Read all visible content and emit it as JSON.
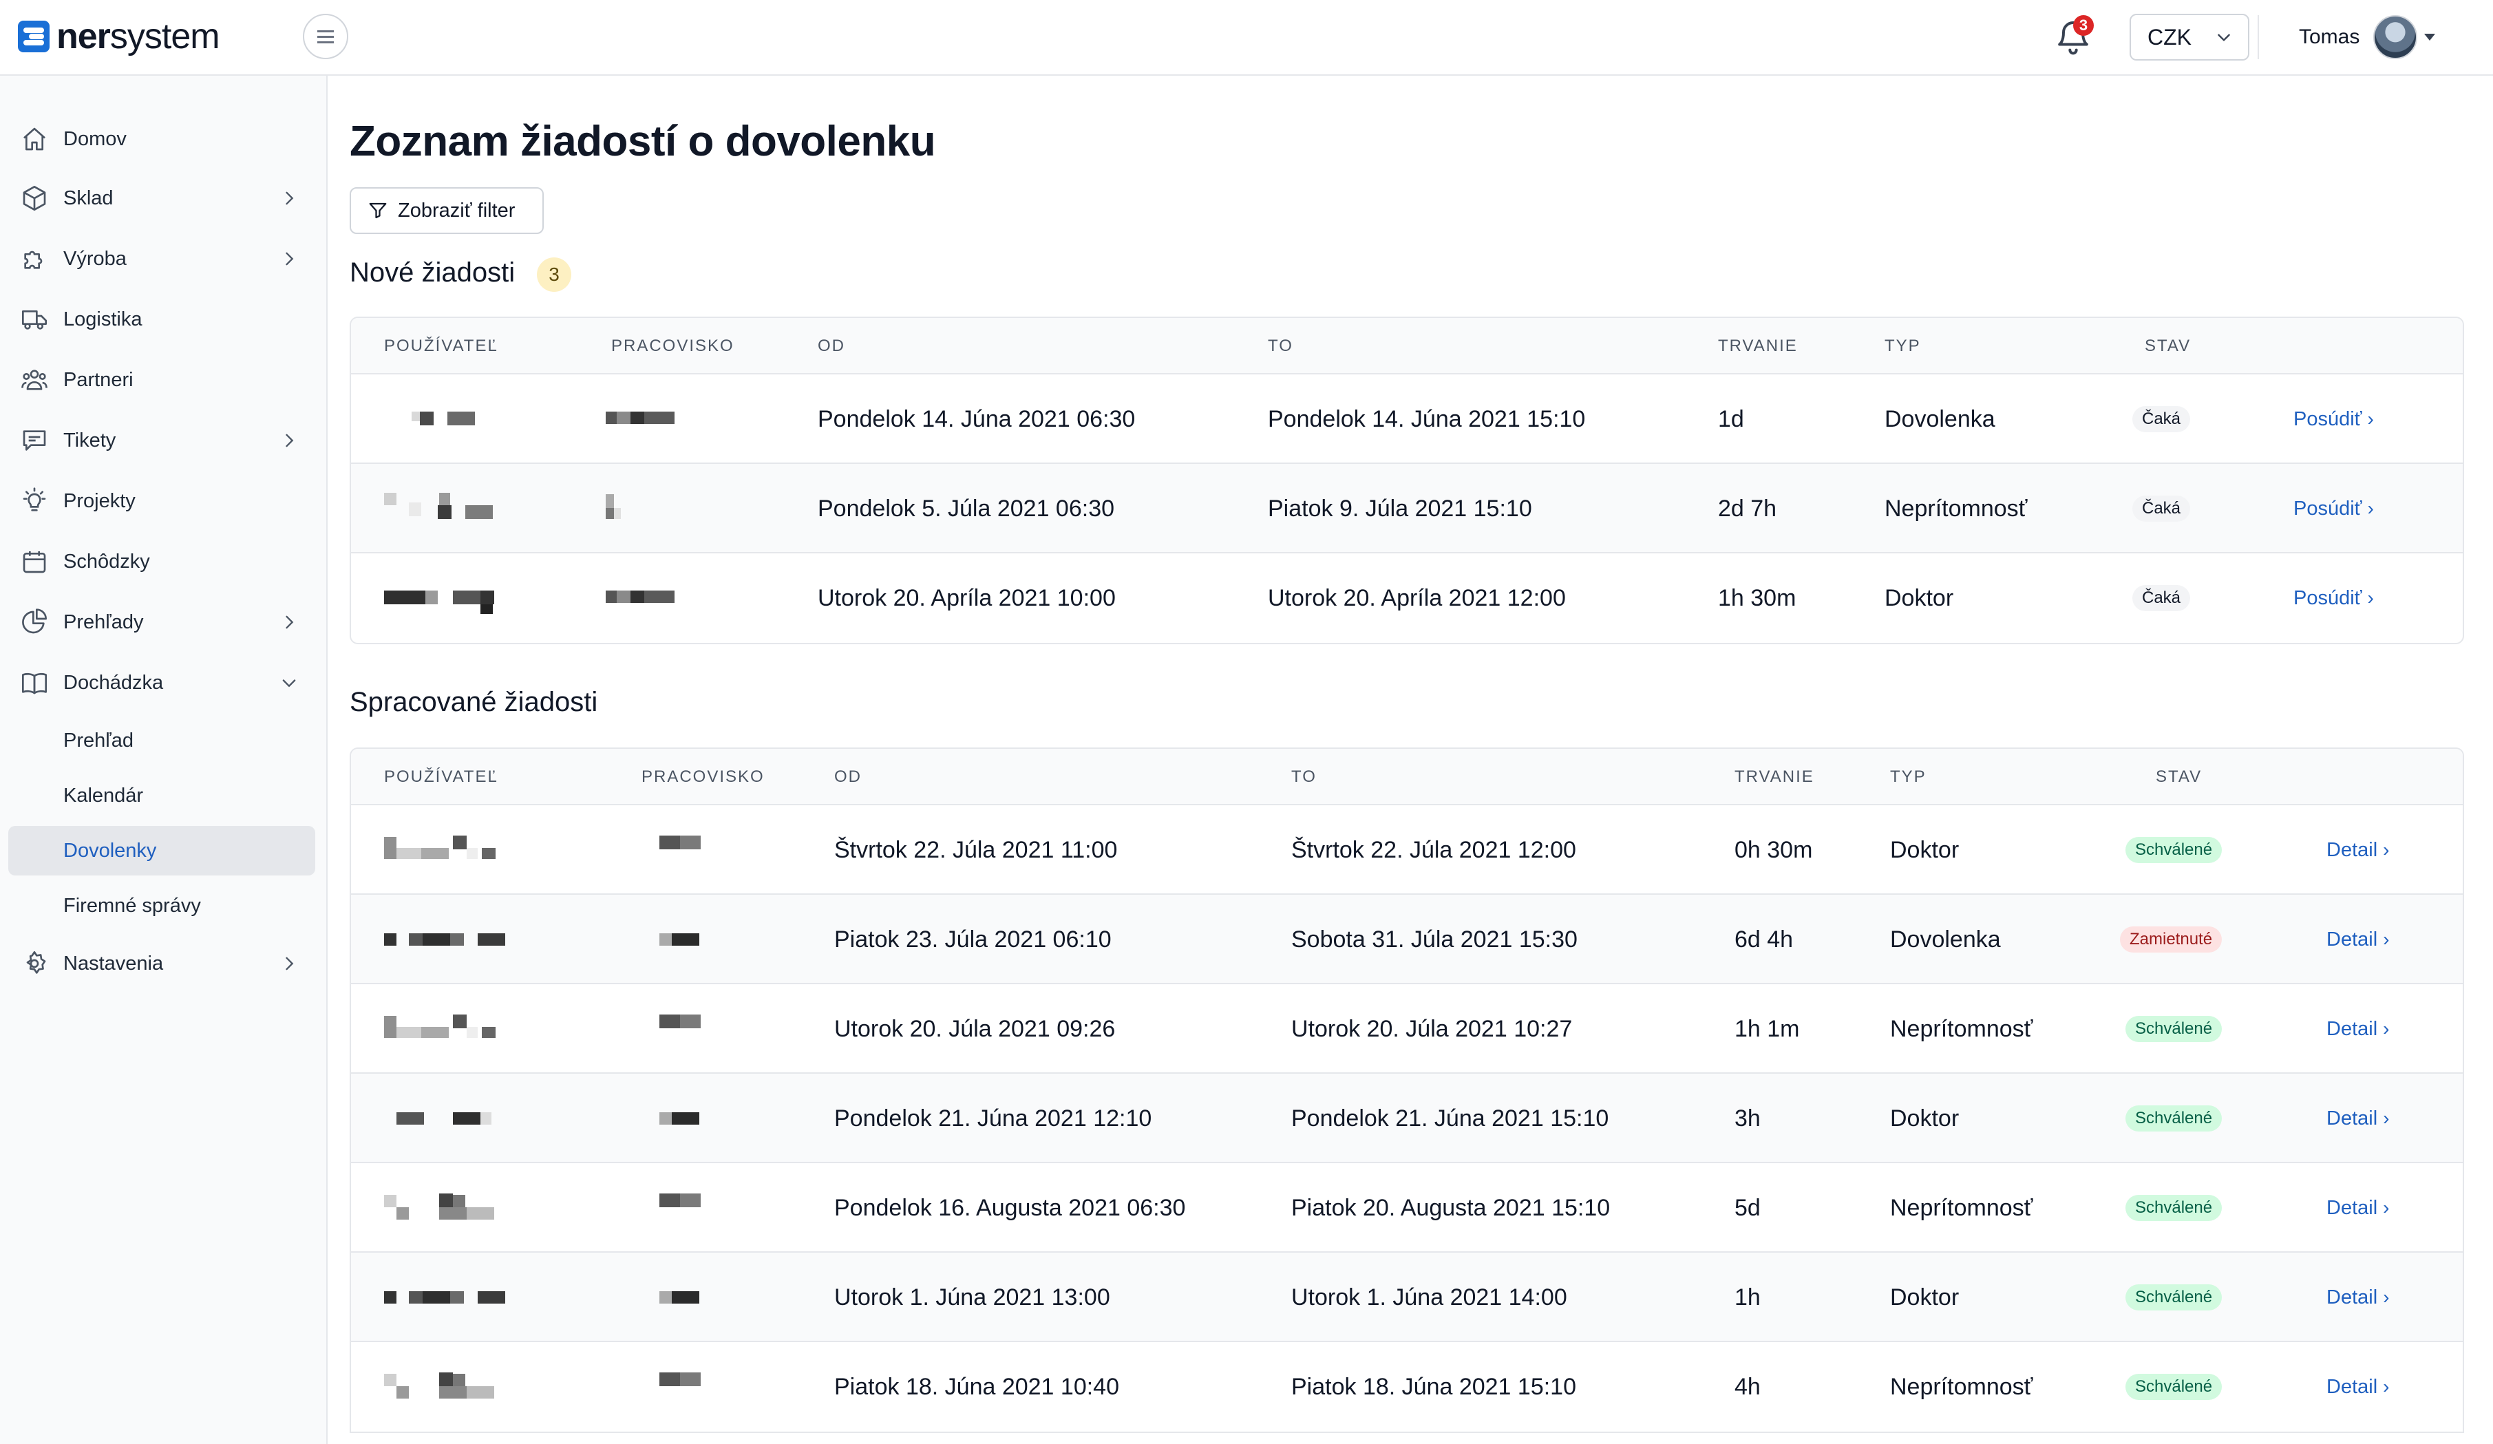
{
  "brand": {
    "name_bold": "ner",
    "name_rest": "system"
  },
  "header": {
    "notifications_count": "3",
    "currency": "CZK",
    "user_name": "Tomas"
  },
  "sidebar": {
    "items": [
      {
        "label": "Domov",
        "icon": "home-icon",
        "has_children": false
      },
      {
        "label": "Sklad",
        "icon": "box-icon",
        "has_children": true
      },
      {
        "label": "Výroba",
        "icon": "puzzle-icon",
        "has_children": true
      },
      {
        "label": "Logistika",
        "icon": "truck-icon",
        "has_children": false
      },
      {
        "label": "Partneri",
        "icon": "users-icon",
        "has_children": false
      },
      {
        "label": "Tikety",
        "icon": "chat-icon",
        "has_children": true
      },
      {
        "label": "Projekty",
        "icon": "lightbulb-icon",
        "has_children": false
      },
      {
        "label": "Schôdzky",
        "icon": "calendar-icon",
        "has_children": false
      },
      {
        "label": "Prehľady",
        "icon": "pie-chart-icon",
        "has_children": true
      },
      {
        "label": "Dochádzka",
        "icon": "book-icon",
        "has_children": true,
        "expanded": true
      },
      {
        "label": "Nastavenia",
        "icon": "gear-icon",
        "has_children": true
      }
    ],
    "sub_items": [
      {
        "label": "Prehľad",
        "active": false
      },
      {
        "label": "Kalendár",
        "active": false
      },
      {
        "label": "Dovolenky",
        "active": true
      },
      {
        "label": "Firemné správy",
        "active": false
      }
    ]
  },
  "main": {
    "title": "Zoznam žiadostí o dovolenku",
    "filter_label": "Zobraziť filter",
    "new_section": {
      "title": "Nové žiadosti",
      "count": "3",
      "columns": [
        "POUŽÍVATEĽ",
        "PRACOVISKO",
        "OD",
        "TO",
        "TRVANIE",
        "TYP",
        "STAV"
      ],
      "rows": [
        {
          "od": "Pondelok 14. Júna 2021 06:30",
          "to": "Pondelok 14. Júna 2021 15:10",
          "trvanie": "1d",
          "typ": "Dovolenka",
          "stav": "Čaká",
          "action": "Posúdiť"
        },
        {
          "od": "Pondelok 5. Júla 2021 06:30",
          "to": "Piatok 9. Júla 2021 15:10",
          "trvanie": "2d 7h",
          "typ": "Neprítomnosť",
          "stav": "Čaká",
          "action": "Posúdiť"
        },
        {
          "od": "Utorok 20. Apríla 2021 10:00",
          "to": "Utorok 20. Apríla 2021 12:00",
          "trvanie": "1h 30m",
          "typ": "Doktor",
          "stav": "Čaká",
          "action": "Posúdiť"
        }
      ]
    },
    "processed_section": {
      "title": "Spracované žiadosti",
      "columns": [
        "POUŽÍVATEĽ",
        "PRACOVISKO",
        "OD",
        "TO",
        "TRVANIE",
        "TYP",
        "STAV"
      ],
      "rows": [
        {
          "od": "Štvrtok 22. Júla 2021 11:00",
          "to": "Štvrtok 22. Júla 2021 12:00",
          "trvanie": "0h 30m",
          "typ": "Doktor",
          "stav": "Schválené",
          "status": "approved",
          "action": "Detail"
        },
        {
          "od": "Piatok 23. Júla 2021 06:10",
          "to": "Sobota 31. Júla 2021 15:30",
          "trvanie": "6d 4h",
          "typ": "Dovolenka",
          "stav": "Zamietnuté",
          "status": "rejected",
          "action": "Detail"
        },
        {
          "od": "Utorok 20. Júla 2021 09:26",
          "to": "Utorok 20. Júla 2021 10:27",
          "trvanie": "1h 1m",
          "typ": "Neprítomnosť",
          "stav": "Schválené",
          "status": "approved",
          "action": "Detail"
        },
        {
          "od": "Pondelok 21. Júna 2021 12:10",
          "to": "Pondelok 21. Júna 2021 15:10",
          "trvanie": "3h",
          "typ": "Doktor",
          "stav": "Schválené",
          "status": "approved",
          "action": "Detail"
        },
        {
          "od": "Pondelok 16. Augusta 2021 06:30",
          "to": "Piatok 20. Augusta 2021 15:10",
          "trvanie": "5d",
          "typ": "Neprítomnosť",
          "stav": "Schválené",
          "status": "approved",
          "action": "Detail"
        },
        {
          "od": "Utorok 1. Júna 2021 13:00",
          "to": "Utorok 1. Júna 2021 14:00",
          "trvanie": "1h",
          "typ": "Doktor",
          "stav": "Schválené",
          "status": "approved",
          "action": "Detail"
        },
        {
          "od": "Piatok 18. Júna 2021 10:40",
          "to": "Piatok 18. Júna 2021 15:10",
          "trvanie": "4h",
          "typ": "Neprítomnosť",
          "stav": "Schválené",
          "status": "approved",
          "action": "Detail"
        }
      ]
    }
  },
  "colors": {
    "accent": "#1f5fbf",
    "approved_bg": "#d1fadf",
    "rejected_bg": "#fde2e2",
    "notification": "#dc2626"
  }
}
